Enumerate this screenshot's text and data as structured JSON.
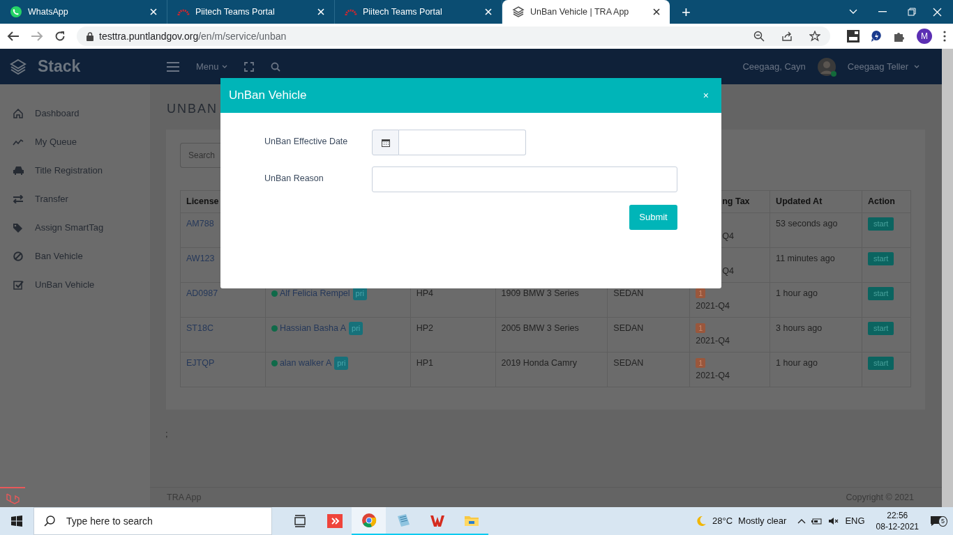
{
  "browser": {
    "tabs": [
      {
        "title": "WhatsApp",
        "selected": false
      },
      {
        "title": "Piitech Teams Portal",
        "selected": false
      },
      {
        "title": "Piitech Teams Portal",
        "selected": false
      },
      {
        "title": "UnBan Vehicle | TRA App",
        "selected": true
      }
    ],
    "new_tab": "+",
    "address": {
      "host": "testtra.puntlandgov.org",
      "path": "/en/m/service/unban"
    },
    "profile": "M"
  },
  "app": {
    "brand": "Stack",
    "menu": "Menu",
    "user_short": "Ceegaag, Cayn",
    "user_name": "Ceegaag Teller"
  },
  "sidebar": {
    "items": [
      {
        "label": "Dashboard"
      },
      {
        "label": "My Queue"
      },
      {
        "label": "Title Registration"
      },
      {
        "label": "Transfer"
      },
      {
        "label": "Assign SmartTag"
      },
      {
        "label": "Ban Vehicle"
      },
      {
        "label": "UnBan Vehicle"
      }
    ]
  },
  "page": {
    "title": "UNBAN",
    "search": {
      "placeholder": "Search"
    },
    "table": {
      "columns": [
        {
          "label": "License"
        },
        {},
        {},
        {},
        {},
        {
          "label": "ng Tax"
        },
        {
          "label": "Updated At"
        },
        {
          "label": "Action"
        }
      ],
      "rows": [
        {
          "license": "AM788",
          "tax": {
            "period": "Q4"
          },
          "updated": "53 seconds ago",
          "action": "start"
        },
        {
          "license": "AW123",
          "tax": {
            "period": "Q4"
          },
          "updated": "11 minutes ago",
          "action": "start"
        },
        {
          "license": "AD0987",
          "owner": {
            "name": "Alf Felicia Rempel",
            "tag": "pri"
          },
          "plate": "HP4",
          "model": "1909 BMW 3 Series",
          "type": "SEDAN",
          "tax": {
            "count": "1",
            "period": "2021-Q4"
          },
          "updated": "1 hour ago",
          "action": "start"
        },
        {
          "license": "ST18C",
          "owner": {
            "name": "Hassian Basha A",
            "tag": "pri"
          },
          "plate": "HP2",
          "model": "2005 BMW 3 Series",
          "type": "SEDAN",
          "tax": {
            "count": "1",
            "period": "2021-Q4"
          },
          "updated": "3 hours ago",
          "action": "start"
        },
        {
          "license": "EJTQP",
          "owner": {
            "name": "alan walker A",
            "tag": "pri"
          },
          "plate": "HP1",
          "model": "2019 Honda Camry",
          "type": "SEDAN",
          "tax": {
            "count": "1",
            "period": "2021-Q4"
          },
          "updated": "1 hour ago",
          "action": "start"
        }
      ]
    },
    "note": ";"
  },
  "footer": {
    "left": "TRA App",
    "right": "Copyright © 2021"
  },
  "modal": {
    "title": "UnBan Vehicle",
    "close": "×",
    "fields": [
      {
        "label": "UnBan Effective Date",
        "kind": "date"
      },
      {
        "label": "UnBan Reason",
        "kind": "text"
      }
    ],
    "submit": "Submit"
  },
  "taskbar": {
    "search": {
      "placeholder": "Type here to search"
    },
    "temperature": "28°C",
    "weather": "Mostly clear",
    "language": "ENG",
    "time": "22:56",
    "date": "08-12-2021",
    "notifications": "5"
  }
}
